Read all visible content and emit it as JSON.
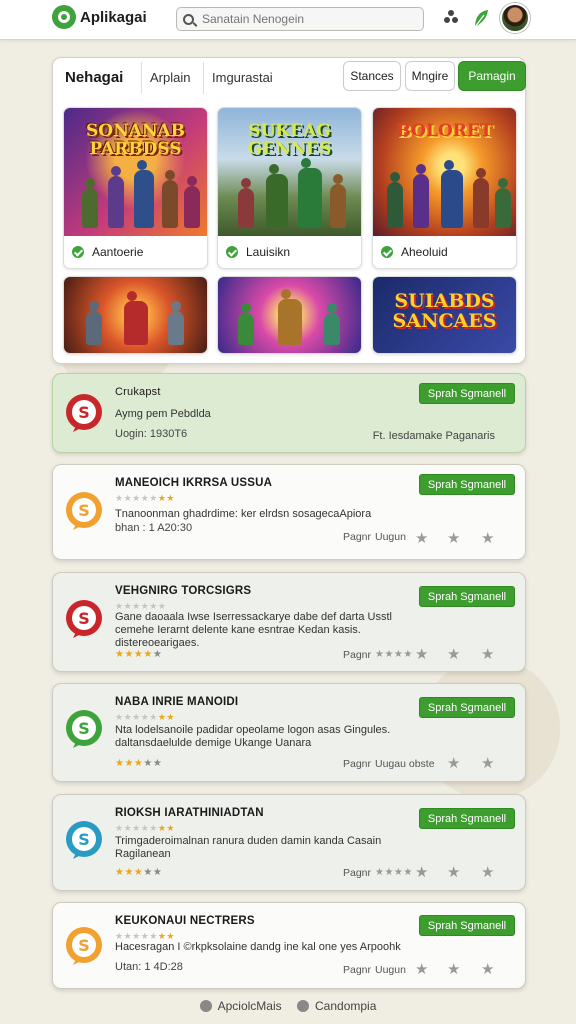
{
  "topbar": {
    "app_title": "Aplikagai",
    "search_placeholder": "Sanatain Nenogein"
  },
  "games": {
    "tabs": [
      "Nehagai",
      "Arplain",
      "Imgurastai"
    ],
    "filters": [
      "Stances",
      "Mngire",
      "Pamagin"
    ],
    "featured": [
      {
        "art_title": "SONANAB PARBDSS",
        "label": "Aantoerie"
      },
      {
        "art_title": "SUKEAG GENNES",
        "label": "Lauisikn"
      },
      {
        "art_title": "BOLORET",
        "label": "Aheoluid"
      }
    ],
    "more": [
      {
        "art_title": ""
      },
      {
        "art_title": ""
      },
      {
        "art_title": "SUIABDS SANCAES"
      }
    ]
  },
  "apps": [
    {
      "name": "Crukapst",
      "subtitle": "Aymg pem Pebdlda",
      "size": "Uogin: 1930T6",
      "button": "Sprah Sgmanell",
      "meta": "Ft. Iesdamake Paganaris",
      "icon_color": "#c8262b",
      "featured": true
    },
    {
      "name": "MANEOICH IKRRSA USSUA",
      "rating": 4,
      "desc": "Tnanoonman ghadrdime: ker elrdsn sosagecaApiora",
      "size": "bhan : 1 A20:30",
      "button": "Sprah Sgmanell",
      "meta": [
        "Pagnr",
        "Uugun"
      ],
      "icon_color": "#f2a130"
    },
    {
      "name": "VEHGNIRG TORCSIGRS",
      "rating": 4,
      "desc": "Gane daoaala Iwse Iserressackarye dabe def darta Usstl cemehe Ierarnt delente kane esntrae Kedan kasis. distereoearigaes.",
      "rating_small": 3.5,
      "button": "Sprah Sgmanell",
      "meta": [
        "Pagnr"
      ],
      "icon_color": "#c8262b"
    },
    {
      "name": "NABA INRIE MANOIDI",
      "rating": 4,
      "desc": "Nta lodelsanoile padidar opeolame logon asas Gingules. daltansdaelulde demige Ukange Uanara",
      "rating_small": 3,
      "button": "Sprah Sgmanell",
      "meta": [
        "Pagnr",
        "Uugau obste"
      ],
      "icon_color": "#3ea33a"
    },
    {
      "name": "RIOKSH IARATHINIADTAN",
      "rating": 4,
      "desc": "Trimgaderoimalnan ranura duden damin kanda Casain Ragilanean",
      "rating_small": 3,
      "button": "Sprah Sgmanell",
      "meta": [
        "Pagnr"
      ],
      "icon_color": "#2a9bc2"
    },
    {
      "name": "KEUKONAUI NECTRERS",
      "rating": 4,
      "desc": "Hacesragan I ©rkpksolaine dandg ine kal one yes Arpoohk",
      "size": "Utan: 1 4D:28",
      "button": "Sprah Sgmanell",
      "meta": [
        "Pagnr",
        "Uugun"
      ],
      "icon_color": "#f2a130"
    }
  ],
  "footer": {
    "links": [
      "ApciolcMais",
      "Candompia"
    ]
  }
}
